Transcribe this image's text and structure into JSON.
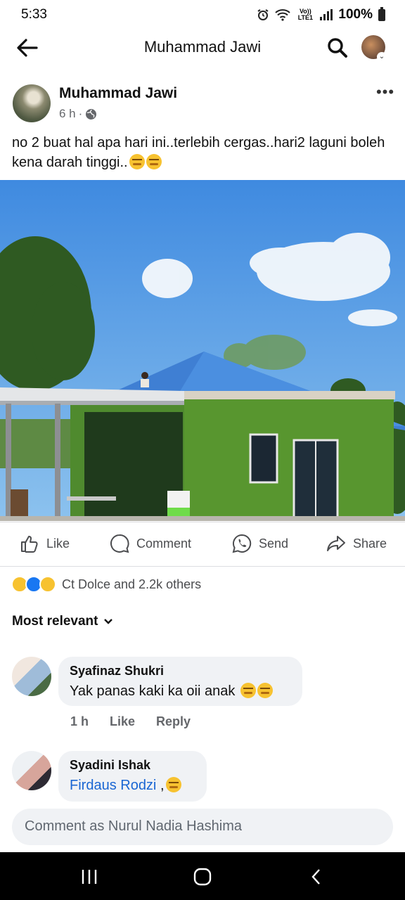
{
  "status": {
    "time": "5:33",
    "network_label": "Vo)) LTE1",
    "battery": "100%"
  },
  "header": {
    "title": "Muhammad Jawi"
  },
  "post": {
    "author": "Muhammad Jawi",
    "time": "6 h",
    "text": "no 2 buat hal apa hari ini..terlebih cergas..hari2 laguni boleh kena darah tinggi..",
    "text_emoji_count": 2
  },
  "actions": {
    "like": "Like",
    "comment": "Comment",
    "send": "Send",
    "share": "Share"
  },
  "reactions": {
    "summary": "Ct Dolce and 2.2k others",
    "types": [
      "haha",
      "like",
      "wow"
    ]
  },
  "sort": {
    "label": "Most relevant"
  },
  "comments": [
    {
      "name": "Syafinaz Shukri",
      "text": "Yak panas kaki ka oii anak",
      "time": "1 h",
      "like": "Like",
      "reply": "Reply"
    },
    {
      "name": "Syadini Ishak",
      "mention": "Firdaus Rodzi",
      "suffix": " ,"
    }
  ],
  "composer": {
    "placeholder": "Comment as Nurul Nadia Hashima"
  },
  "colors": {
    "accent": "#1877f2",
    "mention": "#1a66d3",
    "bubble": "#f0f2f5",
    "wall": "#4f8a2e",
    "roof": "#3f7fd3",
    "sky": "#5aa3e8"
  }
}
